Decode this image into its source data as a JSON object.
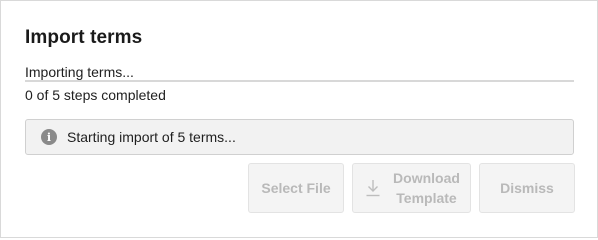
{
  "dialog": {
    "title": "Import terms",
    "status_text": "Importing terms...",
    "progress_fraction": 0,
    "steps_text": "0 of 5 steps completed",
    "info_message": "Starting import of 5 terms...",
    "info_icon": "info-icon"
  },
  "buttons": {
    "select_file": "Select File",
    "download_template": "Download Template",
    "download_icon": "download-icon",
    "dismiss": "Dismiss"
  }
}
